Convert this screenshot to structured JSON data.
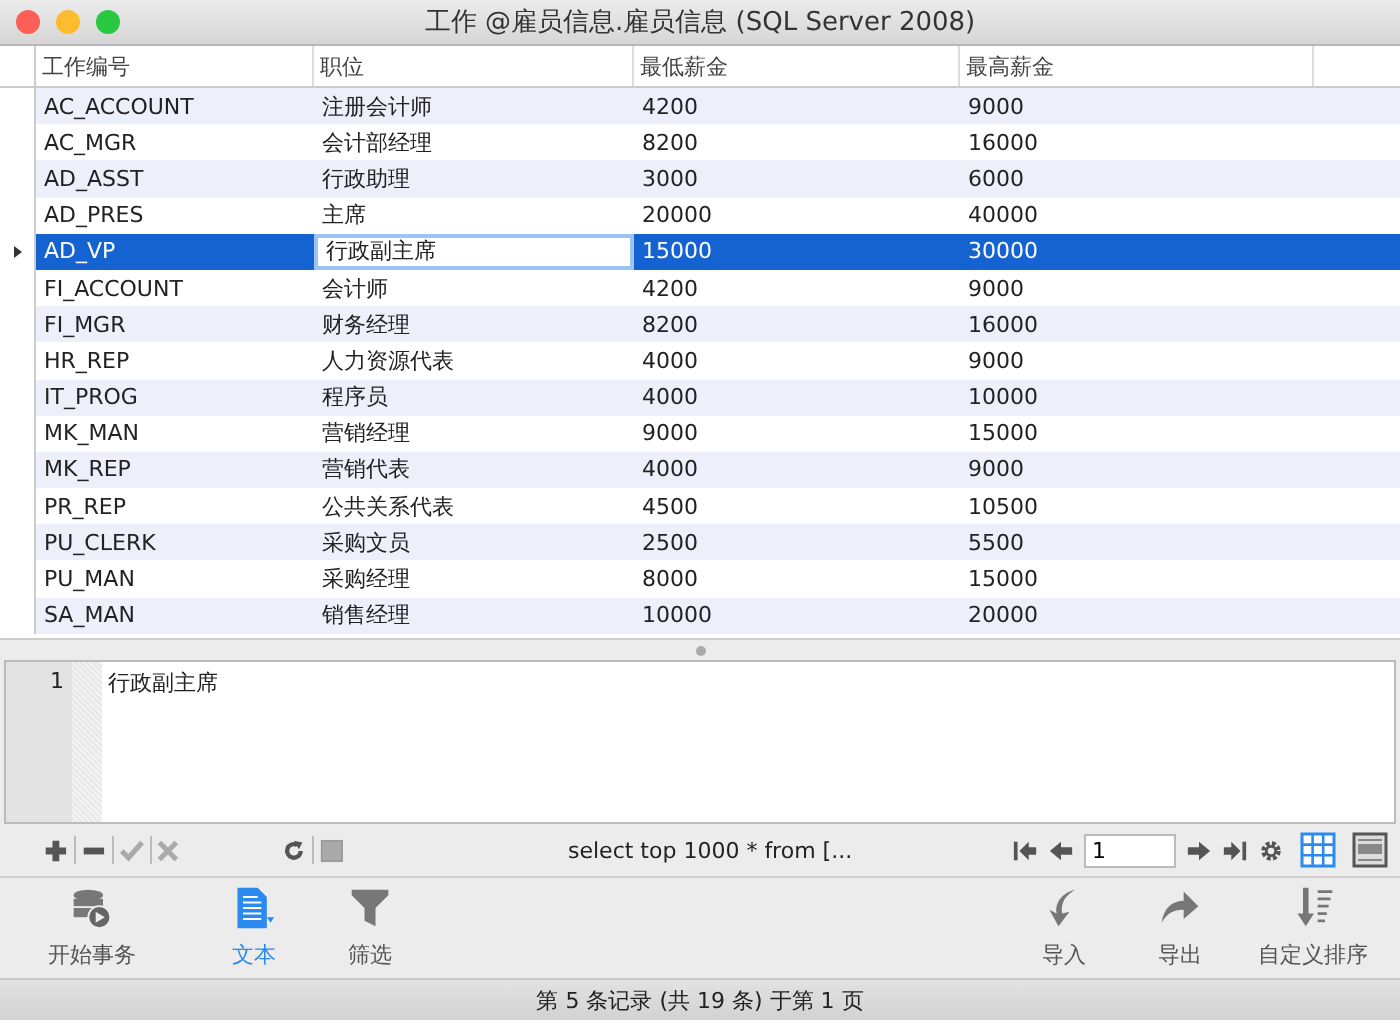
{
  "window": {
    "title": "工作 @雇员信息.雇员信息 (SQL Server 2008)"
  },
  "table": {
    "columns": [
      "工作编号",
      "职位",
      "最低薪金",
      "最高薪金"
    ],
    "rows": [
      {
        "cells": [
          "AC_ACCOUNT",
          "注册会计师",
          "4200",
          "9000"
        ],
        "selected": false
      },
      {
        "cells": [
          "AC_MGR",
          "会计部经理",
          "8200",
          "16000"
        ],
        "selected": false
      },
      {
        "cells": [
          "AD_ASST",
          "行政助理",
          "3000",
          "6000"
        ],
        "selected": false
      },
      {
        "cells": [
          "AD_PRES",
          "主席",
          "20000",
          "40000"
        ],
        "selected": false
      },
      {
        "cells": [
          "AD_VP",
          "行政副主席",
          "15000",
          "30000"
        ],
        "selected": true
      },
      {
        "cells": [
          "FI_ACCOUNT",
          "会计师",
          "4200",
          "9000"
        ],
        "selected": false
      },
      {
        "cells": [
          "FI_MGR",
          "财务经理",
          "8200",
          "16000"
        ],
        "selected": false
      },
      {
        "cells": [
          "HR_REP",
          "人力资源代表",
          "4000",
          "9000"
        ],
        "selected": false
      },
      {
        "cells": [
          "IT_PROG",
          "程序员",
          "4000",
          "10000"
        ],
        "selected": false
      },
      {
        "cells": [
          "MK_MAN",
          "营销经理",
          "9000",
          "15000"
        ],
        "selected": false
      },
      {
        "cells": [
          "MK_REP",
          "营销代表",
          "4000",
          "9000"
        ],
        "selected": false
      },
      {
        "cells": [
          "PR_REP",
          "公共关系代表",
          "4500",
          "10500"
        ],
        "selected": false
      },
      {
        "cells": [
          "PU_CLERK",
          "采购文员",
          "2500",
          "5500"
        ],
        "selected": false
      },
      {
        "cells": [
          "PU_MAN",
          "采购经理",
          "8000",
          "15000"
        ],
        "selected": false
      },
      {
        "cells": [
          "SA_MAN",
          "销售经理",
          "10000",
          "20000"
        ],
        "selected": false
      }
    ]
  },
  "editor": {
    "line_number": "1",
    "text": "行政副主席"
  },
  "query_bar": {
    "sql": "select top 1000 * from [...",
    "page_field": "1"
  },
  "toolbar": [
    {
      "kind": "transaction",
      "label": "开始事务",
      "selected": false
    },
    {
      "kind": "text",
      "label": "文本",
      "selected": true
    },
    {
      "kind": "filter",
      "label": "筛选",
      "selected": false
    },
    {
      "kind": "import",
      "label": "导入",
      "selected": false
    },
    {
      "kind": "export",
      "label": "导出",
      "selected": false
    },
    {
      "kind": "sort",
      "label": "自定义排序",
      "selected": false
    }
  ],
  "status_bar": "第 5 条记录 (共 19 条) 于第 1 页"
}
